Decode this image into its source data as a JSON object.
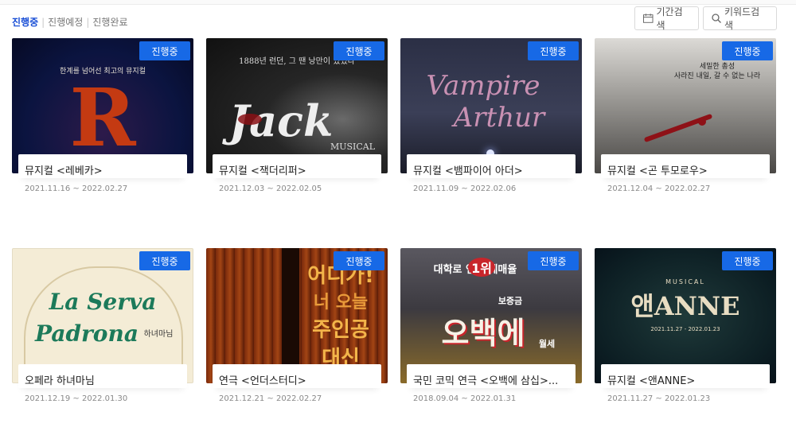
{
  "filters": [
    {
      "label": "진행중",
      "active": true
    },
    {
      "label": "진행예정",
      "active": false
    },
    {
      "label": "진행완료",
      "active": false
    }
  ],
  "tools": {
    "period_label": "기간검색",
    "keyword_label": "키워드검색",
    "period_icon": "calendar-icon",
    "keyword_icon": "search-icon"
  },
  "status_color": "#1769e6",
  "cards": [
    {
      "status": "진행중",
      "title": "뮤지컬 <레베카>",
      "dates": "2021.11.16 ~ 2022.02.27",
      "poster": {
        "top_text": "한계를 넘어선 최고의 뮤지컬",
        "main_text": "R",
        "colors": [
          "#0b1440",
          "#c43a12"
        ]
      }
    },
    {
      "status": "진행중",
      "title": "뮤지컬 <잭더리퍼>",
      "dates": "2021.12.03 ~ 2022.02.05",
      "poster": {
        "top_text": "1888년 런던, 그 땐 낭만이 있었다",
        "main_text": "Jack",
        "sub_text": "MUSICAL",
        "colors": [
          "#1b1b1b",
          "#8a0f14"
        ]
      }
    },
    {
      "status": "진행중",
      "title": "뮤지컬 <뱀파이어 아더>",
      "dates": "2021.11.09 ~ 2022.02.06",
      "poster": {
        "main_text": "Vampire",
        "main_text2": "Arthur",
        "colors": [
          "#2b2f45",
          "#c991b3"
        ]
      }
    },
    {
      "status": "진행중",
      "title": "뮤지컬 <곤 투모로우>",
      "dates": "2021.12.04 ~ 2022.02.27",
      "poster": {
        "top_text": "세밀한 총성",
        "top_text2": "사라진 내일, 갈 수 없는 나라",
        "colors": [
          "#d6d4d0",
          "#8e1117"
        ]
      }
    },
    {
      "status": "진행중",
      "title": "오페라 하녀마님",
      "dates": "2021.12.19 ~ 2022.01.30",
      "poster": {
        "main_text": "La Serva",
        "main_text2": "Padrona",
        "sub_text": "하녀마님",
        "colors": [
          "#f4ecd6",
          "#1c7a5a"
        ]
      }
    },
    {
      "status": "진행중",
      "title": "연극 <언더스터디>",
      "dates": "2021.12.21 ~ 2022.02.27",
      "poster": {
        "main_text": "어디가!",
        "main_text2": "너 오늘",
        "main_text3": "주인공",
        "main_text4": "대신",
        "colors": [
          "#6b1f0a",
          "#f3b54a"
        ]
      }
    },
    {
      "status": "진행중",
      "title": "국민 코믹 연극 <오백에 삼십>...",
      "dates": "2018.09.04 ~ 2022.01.31",
      "poster": {
        "top_text": "대학로 연극 예매율",
        "rank_text": "1위",
        "main_text": "오백에",
        "sub_text": "보증금",
        "sub_text2": "월세",
        "colors": [
          "#3c3a40",
          "#f0c13a"
        ]
      }
    },
    {
      "status": "진행중",
      "title": "뮤지컬 <앤ANNE>",
      "dates": "2021.11.27 ~ 2022.01.23",
      "poster": {
        "top_text": "MUSICAL",
        "main_text": "앤ANNE",
        "sub_text": "2021.11.27 - 2022.01.23",
        "colors": [
          "#0d1f24",
          "#e8ddc2"
        ]
      }
    }
  ]
}
